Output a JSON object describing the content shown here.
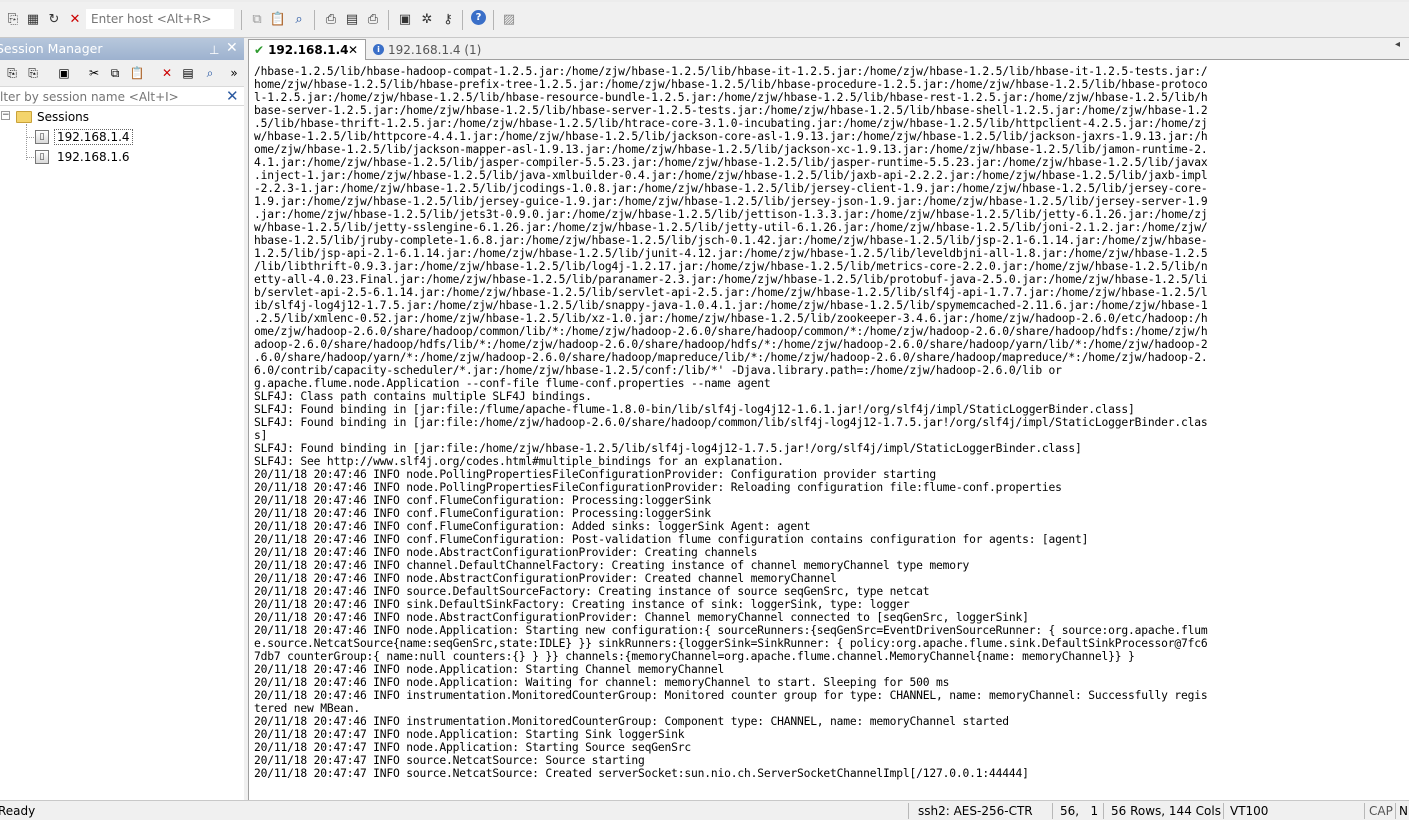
{
  "toolbar": {
    "host_placeholder": "Enter host <Alt+R>",
    "icons": [
      "connect-icon",
      "quick-connect-icon",
      "reconnect-icon",
      "disconnect-icon",
      "copy-icon",
      "paste-icon",
      "find-icon",
      "print-icon",
      "print-setup-icon",
      "print-screen-icon",
      "session-options-icon",
      "global-options-icon",
      "key-icon",
      "help-icon",
      "lock-icon"
    ]
  },
  "session_manager": {
    "title": "Session Manager",
    "filter_placeholder": "lter by session name <Alt+I>",
    "root": "Sessions",
    "sessions": [
      "192.168.1.4",
      "192.168.1.6"
    ]
  },
  "tabs": [
    {
      "label": "192.168.1.4",
      "active": true
    },
    {
      "label": "192.168.1.4 (1)",
      "active": false
    }
  ],
  "terminal": {
    "lines": [
      "/hbase-1.2.5/lib/hbase-hadoop-compat-1.2.5.jar:/home/zjw/hbase-1.2.5/lib/hbase-it-1.2.5.jar:/home/zjw/hbase-1.2.5/lib/hbase-it-1.2.5-tests.jar:/",
      "home/zjw/hbase-1.2.5/lib/hbase-prefix-tree-1.2.5.jar:/home/zjw/hbase-1.2.5/lib/hbase-procedure-1.2.5.jar:/home/zjw/hbase-1.2.5/lib/hbase-protoco",
      "l-1.2.5.jar:/home/zjw/hbase-1.2.5/lib/hbase-resource-bundle-1.2.5.jar:/home/zjw/hbase-1.2.5/lib/hbase-rest-1.2.5.jar:/home/zjw/hbase-1.2.5/lib/h",
      "base-server-1.2.5.jar:/home/zjw/hbase-1.2.5/lib/hbase-server-1.2.5-tests.jar:/home/zjw/hbase-1.2.5/lib/hbase-shell-1.2.5.jar:/home/zjw/hbase-1.2",
      ".5/lib/hbase-thrift-1.2.5.jar:/home/zjw/hbase-1.2.5/lib/htrace-core-3.1.0-incubating.jar:/home/zjw/hbase-1.2.5/lib/httpclient-4.2.5.jar:/home/zj",
      "w/hbase-1.2.5/lib/httpcore-4.4.1.jar:/home/zjw/hbase-1.2.5/lib/jackson-core-asl-1.9.13.jar:/home/zjw/hbase-1.2.5/lib/jackson-jaxrs-1.9.13.jar:/h",
      "ome/zjw/hbase-1.2.5/lib/jackson-mapper-asl-1.9.13.jar:/home/zjw/hbase-1.2.5/lib/jackson-xc-1.9.13.jar:/home/zjw/hbase-1.2.5/lib/jamon-runtime-2.",
      "4.1.jar:/home/zjw/hbase-1.2.5/lib/jasper-compiler-5.5.23.jar:/home/zjw/hbase-1.2.5/lib/jasper-runtime-5.5.23.jar:/home/zjw/hbase-1.2.5/lib/javax",
      ".inject-1.jar:/home/zjw/hbase-1.2.5/lib/java-xmlbuilder-0.4.jar:/home/zjw/hbase-1.2.5/lib/jaxb-api-2.2.2.jar:/home/zjw/hbase-1.2.5/lib/jaxb-impl",
      "-2.2.3-1.jar:/home/zjw/hbase-1.2.5/lib/jcodings-1.0.8.jar:/home/zjw/hbase-1.2.5/lib/jersey-client-1.9.jar:/home/zjw/hbase-1.2.5/lib/jersey-core-",
      "1.9.jar:/home/zjw/hbase-1.2.5/lib/jersey-guice-1.9.jar:/home/zjw/hbase-1.2.5/lib/jersey-json-1.9.jar:/home/zjw/hbase-1.2.5/lib/jersey-server-1.9",
      ".jar:/home/zjw/hbase-1.2.5/lib/jets3t-0.9.0.jar:/home/zjw/hbase-1.2.5/lib/jettison-1.3.3.jar:/home/zjw/hbase-1.2.5/lib/jetty-6.1.26.jar:/home/zj",
      "w/hbase-1.2.5/lib/jetty-sslengine-6.1.26.jar:/home/zjw/hbase-1.2.5/lib/jetty-util-6.1.26.jar:/home/zjw/hbase-1.2.5/lib/joni-2.1.2.jar:/home/zjw/",
      "hbase-1.2.5/lib/jruby-complete-1.6.8.jar:/home/zjw/hbase-1.2.5/lib/jsch-0.1.42.jar:/home/zjw/hbase-1.2.5/lib/jsp-2.1-6.1.14.jar:/home/zjw/hbase-",
      "1.2.5/lib/jsp-api-2.1-6.1.14.jar:/home/zjw/hbase-1.2.5/lib/junit-4.12.jar:/home/zjw/hbase-1.2.5/lib/leveldbjni-all-1.8.jar:/home/zjw/hbase-1.2.5",
      "/lib/libthrift-0.9.3.jar:/home/zjw/hbase-1.2.5/lib/log4j-1.2.17.jar:/home/zjw/hbase-1.2.5/lib/metrics-core-2.2.0.jar:/home/zjw/hbase-1.2.5/lib/n",
      "etty-all-4.0.23.Final.jar:/home/zjw/hbase-1.2.5/lib/paranamer-2.3.jar:/home/zjw/hbase-1.2.5/lib/protobuf-java-2.5.0.jar:/home/zjw/hbase-1.2.5/li",
      "b/servlet-api-2.5-6.1.14.jar:/home/zjw/hbase-1.2.5/lib/servlet-api-2.5.jar:/home/zjw/hbase-1.2.5/lib/slf4j-api-1.7.7.jar:/home/zjw/hbase-1.2.5/l",
      "ib/slf4j-log4j12-1.7.5.jar:/home/zjw/hbase-1.2.5/lib/snappy-java-1.0.4.1.jar:/home/zjw/hbase-1.2.5/lib/spymemcached-2.11.6.jar:/home/zjw/hbase-1",
      ".2.5/lib/xmlenc-0.52.jar:/home/zjw/hbase-1.2.5/lib/xz-1.0.jar:/home/zjw/hbase-1.2.5/lib/zookeeper-3.4.6.jar:/home/zjw/hadoop-2.6.0/etc/hadoop:/h",
      "ome/zjw/hadoop-2.6.0/share/hadoop/common/lib/*:/home/zjw/hadoop-2.6.0/share/hadoop/common/*:/home/zjw/hadoop-2.6.0/share/hadoop/hdfs:/home/zjw/h",
      "adoop-2.6.0/share/hadoop/hdfs/lib/*:/home/zjw/hadoop-2.6.0/share/hadoop/hdfs/*:/home/zjw/hadoop-2.6.0/share/hadoop/yarn/lib/*:/home/zjw/hadoop-2",
      ".6.0/share/hadoop/yarn/*:/home/zjw/hadoop-2.6.0/share/hadoop/mapreduce/lib/*:/home/zjw/hadoop-2.6.0/share/hadoop/mapreduce/*:/home/zjw/hadoop-2.",
      "6.0/contrib/capacity-scheduler/*.jar:/home/zjw/hbase-1.2.5/conf:/lib/*' -Djava.library.path=:/home/zjw/hadoop-2.6.0/lib or",
      "g.apache.flume.node.Application --conf-file flume-conf.properties --name agent",
      "SLF4J: Class path contains multiple SLF4J bindings.",
      "SLF4J: Found binding in [jar:file:/flume/apache-flume-1.8.0-bin/lib/slf4j-log4j12-1.6.1.jar!/org/slf4j/impl/StaticLoggerBinder.class]",
      "SLF4J: Found binding in [jar:file:/home/zjw/hadoop-2.6.0/share/hadoop/common/lib/slf4j-log4j12-1.7.5.jar!/org/slf4j/impl/StaticLoggerBinder.clas",
      "s]",
      "SLF4J: Found binding in [jar:file:/home/zjw/hbase-1.2.5/lib/slf4j-log4j12-1.7.5.jar!/org/slf4j/impl/StaticLoggerBinder.class]",
      "SLF4J: See http://www.slf4j.org/codes.html#multiple_bindings for an explanation.",
      "20/11/18 20:47:46 INFO node.PollingPropertiesFileConfigurationProvider: Configuration provider starting",
      "20/11/18 20:47:46 INFO node.PollingPropertiesFileConfigurationProvider: Reloading configuration file:flume-conf.properties",
      "20/11/18 20:47:46 INFO conf.FlumeConfiguration: Processing:loggerSink",
      "20/11/18 20:47:46 INFO conf.FlumeConfiguration: Processing:loggerSink",
      "20/11/18 20:47:46 INFO conf.FlumeConfiguration: Added sinks: loggerSink Agent: agent",
      "20/11/18 20:47:46 INFO conf.FlumeConfiguration: Post-validation flume configuration contains configuration for agents: [agent]",
      "20/11/18 20:47:46 INFO node.AbstractConfigurationProvider: Creating channels",
      "20/11/18 20:47:46 INFO channel.DefaultChannelFactory: Creating instance of channel memoryChannel type memory",
      "20/11/18 20:47:46 INFO node.AbstractConfigurationProvider: Created channel memoryChannel",
      "20/11/18 20:47:46 INFO source.DefaultSourceFactory: Creating instance of source seqGenSrc, type netcat",
      "20/11/18 20:47:46 INFO sink.DefaultSinkFactory: Creating instance of sink: loggerSink, type: logger",
      "20/11/18 20:47:46 INFO node.AbstractConfigurationProvider: Channel memoryChannel connected to [seqGenSrc, loggerSink]",
      "20/11/18 20:47:46 INFO node.Application: Starting new configuration:{ sourceRunners:{seqGenSrc=EventDrivenSourceRunner: { source:org.apache.flum",
      "e.source.NetcatSource{name:seqGenSrc,state:IDLE} }} sinkRunners:{loggerSink=SinkRunner: { policy:org.apache.flume.sink.DefaultSinkProcessor@7fc6",
      "7db7 counterGroup:{ name:null counters:{} } }} channels:{memoryChannel=org.apache.flume.channel.MemoryChannel{name: memoryChannel}} }",
      "20/11/18 20:47:46 INFO node.Application: Starting Channel memoryChannel",
      "20/11/18 20:47:46 INFO node.Application: Waiting for channel: memoryChannel to start. Sleeping for 500 ms",
      "20/11/18 20:47:46 INFO instrumentation.MonitoredCounterGroup: Monitored counter group for type: CHANNEL, name: memoryChannel: Successfully regis",
      "tered new MBean.",
      "20/11/18 20:47:46 INFO instrumentation.MonitoredCounterGroup: Component type: CHANNEL, name: memoryChannel started",
      "20/11/18 20:47:47 INFO node.Application: Starting Sink loggerSink",
      "20/11/18 20:47:47 INFO node.Application: Starting Source seqGenSrc",
      "20/11/18 20:47:47 INFO source.NetcatSource: Source starting",
      "20/11/18 20:47:47 INFO source.NetcatSource: Created serverSocket:sun.nio.ch.ServerSocketChannelImpl[/127.0.0.1:44444]"
    ]
  },
  "status_bar": {
    "ready": "Ready",
    "cipher": "ssh2: AES-256-CTR",
    "cursor": "56,   1",
    "size": "56 Rows, 144 Cols",
    "emulation": "VT100",
    "caps": "CAP",
    "num": "N"
  }
}
